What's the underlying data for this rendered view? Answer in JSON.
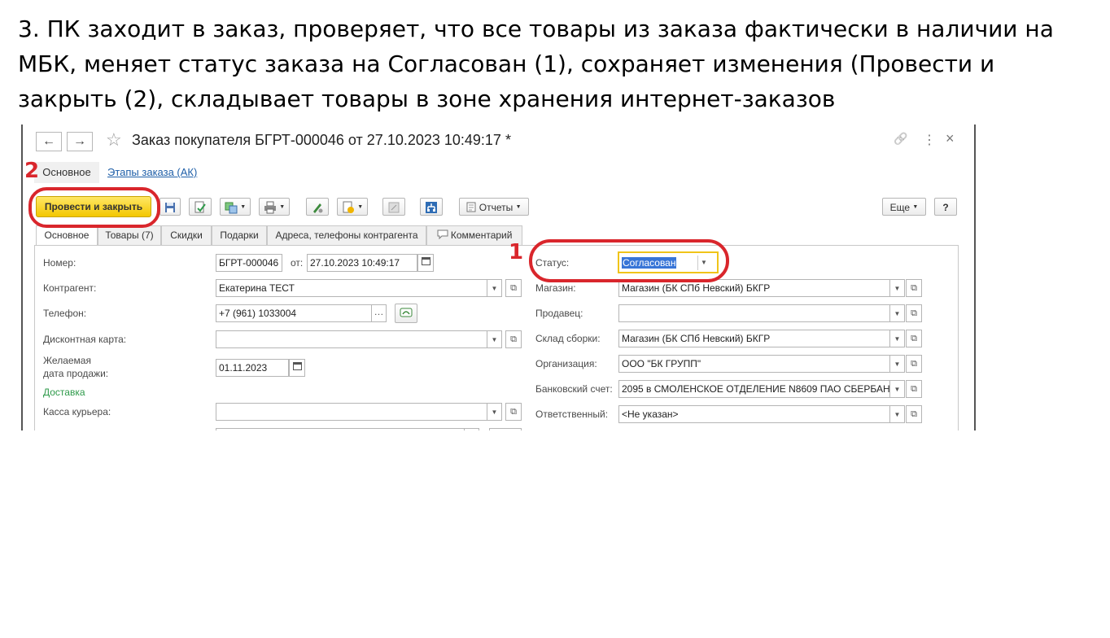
{
  "caption": "3. ПК заходит в заказ, проверяет, что все товары из заказа фактически в наличии на МБК, меняет статус заказа на Согласован (1), сохраняет изменения (Провести и закрыть (2), складывает товары в зоне хранения интернет-заказов",
  "window": {
    "title": "Заказ покупателя БГРТ-000046 от 27.10.2023 10:49:17 *",
    "back_icon": "←",
    "forward_icon": "→",
    "star_icon": "☆",
    "link_icon": "🔗",
    "more_icon": "⋮",
    "close_icon": "×"
  },
  "form_tabs": {
    "main": "Основное",
    "stages": "Этапы заказа (АК)"
  },
  "toolbar": {
    "post_and_close": "Провести и закрыть",
    "reports": "Отчеты",
    "more": "Еще",
    "help": "?"
  },
  "tabs": [
    "Основное",
    "Товары (7)",
    "Скидки",
    "Подарки",
    "Адреса, телефоны контрагента",
    "Комментарий"
  ],
  "fields": {
    "number_label": "Номер:",
    "number_value": "БГРТ-000046",
    "from_label": "от:",
    "date_value": "27.10.2023 10:49:17",
    "counterparty_label": "Контрагент:",
    "counterparty_value": "Екатерина ТЕСТ",
    "phone_label": "Телефон:",
    "phone_value": "+7 (961) 1033004",
    "discount_card_label": "Дисконтная карта:",
    "desired_date_label_1": "Желаемая",
    "desired_date_label_2": "дата продажи:",
    "desired_date_value": "01.11.2023",
    "delivery_link": "Доставка",
    "courier_cash_label": "Касса курьера:",
    "status_label": "Статус:",
    "status_value": "Согласован",
    "store_label": "Магазин:",
    "store_value": "Магазин (БК СПб Невский) БКГР",
    "seller_label": "Продавец:",
    "assembly_warehouse_label": "Склад сборки:",
    "assembly_warehouse_value": "Магазин (БК СПб Невский) БКГР",
    "organization_label": "Организация:",
    "organization_value": "ООО \"БК ГРУПП\"",
    "bank_account_label": "Банковский счет:",
    "bank_account_value": "2095 в СМОЛЕНСКОЕ ОТДЕЛЕНИЕ N8609 ПАО СБЕРБАН",
    "responsible_label": "Ответственный:",
    "responsible_value": "<Не указан>"
  },
  "annotations": {
    "one": "1",
    "two": "2"
  },
  "colors": {
    "primary_button": "#f3c700",
    "annotation_red": "#d9262c",
    "link": "#1f5fa8",
    "delivery": "#2e9a4a"
  }
}
